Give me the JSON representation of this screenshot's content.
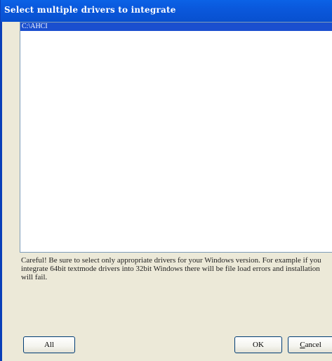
{
  "window": {
    "title": "Select multiple drivers to integrate"
  },
  "driver_list": {
    "items": [
      {
        "label": "C:\\AHCI",
        "selected": true
      }
    ]
  },
  "warning": {
    "text": "Careful! Be sure to select only appropriate drivers for your Windows version. For example if you integrate 64bit textmode drivers into 32bit Windows there will be file load errors and installation will fail."
  },
  "buttons": {
    "all_label": "All",
    "ok_label": "OK",
    "cancel_label": "Cancel",
    "cancel_mnemonic": "C",
    "cancel_rest": "ancel"
  },
  "colors": {
    "titlebar": "#0a58dc",
    "dialog_bg": "#ece9d8",
    "selection": "#1a4fcf"
  }
}
